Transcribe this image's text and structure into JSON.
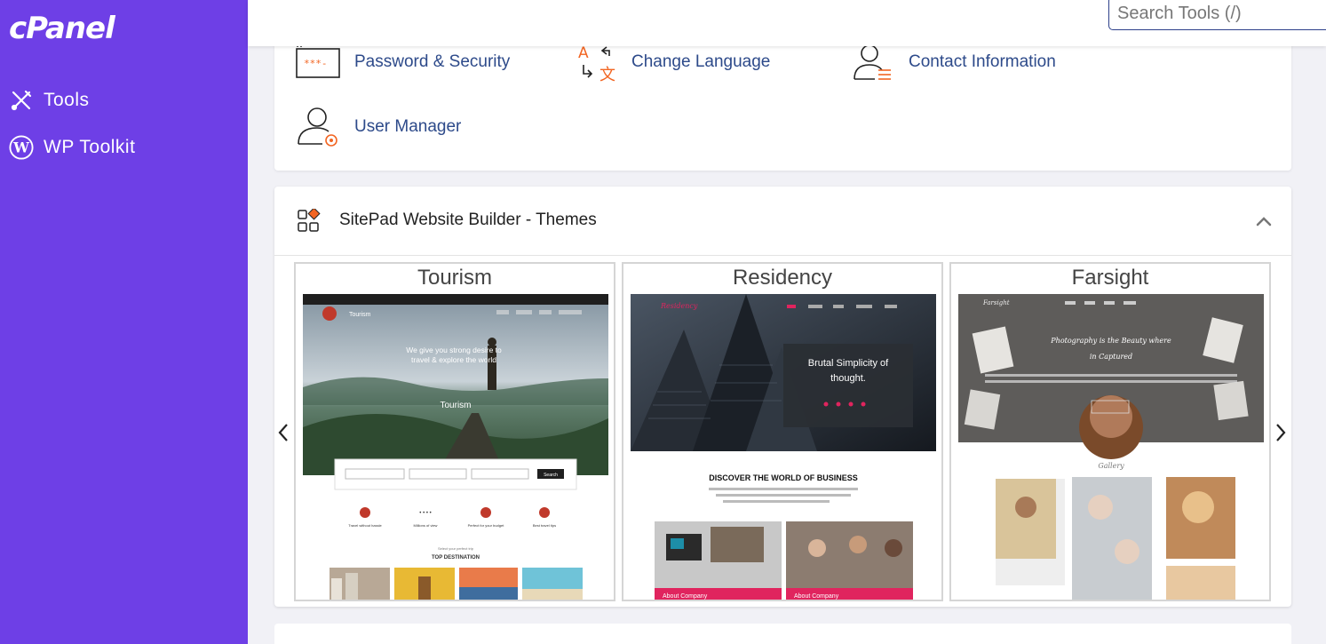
{
  "sidebar": {
    "logo": "cPanel",
    "items": [
      {
        "label": "Tools",
        "icon": "tools-icon"
      },
      {
        "label": "WP Toolkit",
        "icon": "wordpress-icon"
      }
    ]
  },
  "header": {
    "search_placeholder": "Search Tools (/)"
  },
  "preferences": {
    "tools": [
      {
        "label": "Password & Security",
        "icon": "password-icon"
      },
      {
        "label": "Change Language",
        "icon": "language-icon"
      },
      {
        "label": "Contact Information",
        "icon": "contact-icon"
      },
      {
        "label": "User Manager",
        "icon": "user-manager-icon"
      }
    ]
  },
  "sitepad": {
    "title": "SitePad Website Builder - Themes",
    "themes": [
      {
        "name": "Tourism",
        "brand": "Tourism",
        "hero_text": "We give you strong desire to travel & explore the world",
        "hero_sub": "Tourism",
        "search_button": "Search",
        "features": [
          "Travel without hassle",
          "Millions of view",
          "Perfect for your budget",
          "Best travel tips"
        ],
        "section_kicker": "Select your perfect trip",
        "section_title": "TOP DESTINATION"
      },
      {
        "name": "Residency",
        "brand": "Residency",
        "hero_text": "Brutal Simplicity of thought.",
        "section_title": "DISCOVER THE WORLD OF BUSINESS",
        "tiles": [
          "About Company",
          "About Company"
        ]
      },
      {
        "name": "Farsight",
        "brand": "Farsight",
        "hero_text": "Photography is the Beauty where in Captured",
        "section_title": "Gallery"
      }
    ]
  },
  "colors": {
    "sidebar": "#6e3fe6",
    "accent": "#f26522",
    "link": "#2d4a8a"
  }
}
